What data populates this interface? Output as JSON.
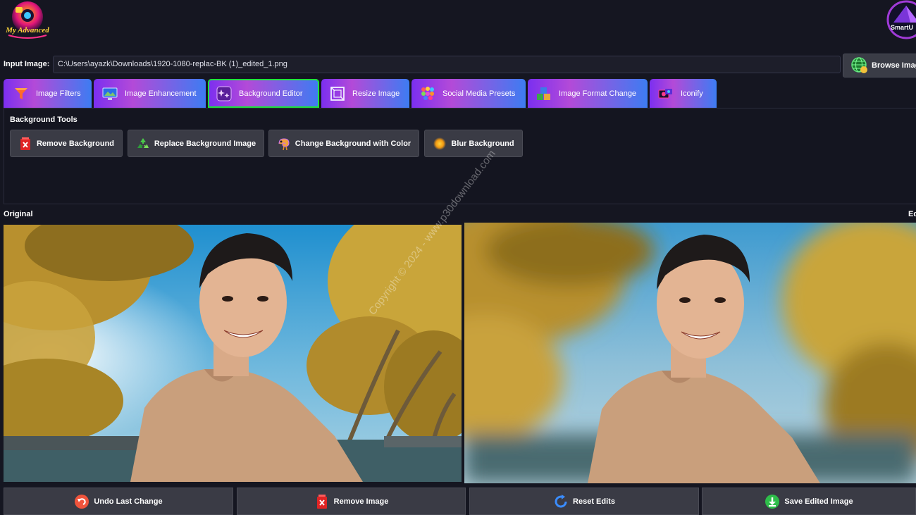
{
  "header": {
    "logo_text": "My Advanced",
    "brand_text": "SmartU"
  },
  "input": {
    "label": "Input Image:",
    "value": "C:\\Users\\ayazk\\Downloads\\1920-1080-replac-BK (1)_edited_1.png",
    "browse_label": "Browse Imag"
  },
  "tabs": [
    {
      "label": "Image Filters",
      "icon": "funnel-icon"
    },
    {
      "label": "Image Enhancement",
      "icon": "monitor-icon"
    },
    {
      "label": "Background Editor",
      "icon": "sparkle-icon",
      "active": true
    },
    {
      "label": "Resize Image",
      "icon": "resize-icon"
    },
    {
      "label": "Social Media Presets",
      "icon": "social-grid-icon"
    },
    {
      "label": "Image Format Change",
      "icon": "format-blocks-icon"
    },
    {
      "label": "Iconify",
      "icon": "iconify-icon"
    }
  ],
  "tools": {
    "title": "Background Tools",
    "buttons": [
      {
        "label": "Remove Background",
        "icon": "red-x-icon"
      },
      {
        "label": "Replace Background Image",
        "icon": "recycle-icon"
      },
      {
        "label": "Change Background with Color",
        "icon": "chameleon-icon"
      },
      {
        "label": "Blur Background",
        "icon": "orange-glow-icon"
      }
    ]
  },
  "panes": {
    "original_label": "Original",
    "edited_label": "Ed"
  },
  "bottom": {
    "undo": "Undo Last Change",
    "remove": "Remove Image",
    "reset": "Reset Edits",
    "save": "Save Edited Image"
  },
  "watermark": "Copyright © 2024 - www.p30download.com",
  "colors": {
    "background": "#151621",
    "tab_gradient_start": "#7b2ff0",
    "tab_gradient_end": "#3d7cf2",
    "active_tab_border": "#1ee13b",
    "button_bg": "#3a3b45"
  }
}
